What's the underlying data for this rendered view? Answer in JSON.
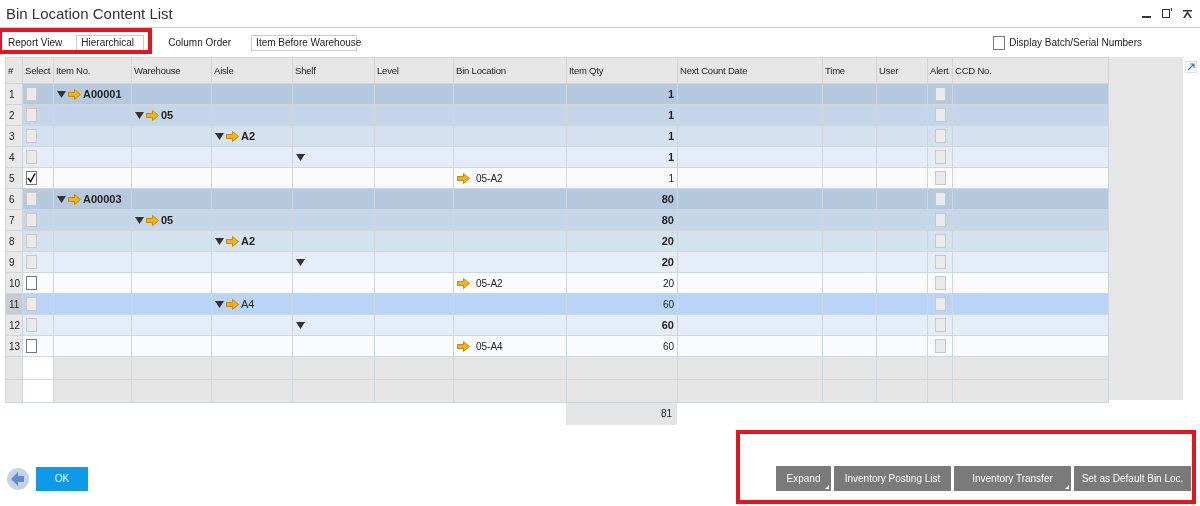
{
  "window": {
    "title": "Bin Location Content List"
  },
  "filters": {
    "highlighted": true,
    "report_view": {
      "label": "Report View",
      "value": "Hierarchical"
    },
    "column_order": {
      "label": "Column Order",
      "value": "Item Before Warehouse"
    },
    "display_batch": {
      "label": "Display Batch/Serial Numbers",
      "checked": false
    }
  },
  "table": {
    "columns": [
      "#",
      "Select",
      "Item No.",
      "Warehouse",
      "Aisle",
      "Shelf",
      "Level",
      "Bin Location",
      "Item Qty",
      "Next Count Date",
      "Time",
      "User",
      "Alert",
      "CCD No."
    ],
    "rows": [
      {
        "num": "1",
        "selected": false,
        "checked": false,
        "alert": false,
        "expanded": true,
        "label": "A00001",
        "qty": "1",
        "children": [
          {
            "num": "2",
            "selected": false,
            "checked": false,
            "alert": false,
            "expanded": true,
            "label": "05",
            "qty": "1",
            "children": [
              {
                "num": "3",
                "selected": false,
                "checked": false,
                "alert": false,
                "expanded": true,
                "label": "A2",
                "qty": "1",
                "children": [
                  {
                    "num": "4",
                    "selected": false,
                    "checked": false,
                    "alert": false,
                    "expanded": true,
                    "qty": "1",
                    "children": [
                      {
                        "num": "5",
                        "selected": false,
                        "checked": true,
                        "alert": false,
                        "label": "05-A2",
                        "qty": "1"
                      }
                    ]
                  }
                ]
              }
            ]
          }
        ]
      },
      {
        "num": "6",
        "selected": false,
        "checked": false,
        "alert": false,
        "expanded": true,
        "label": "A00003",
        "qty": "80",
        "children": [
          {
            "num": "7",
            "selected": false,
            "checked": false,
            "alert": false,
            "expanded": true,
            "label": "05",
            "qty": "80",
            "children": [
              {
                "num": "8",
                "selected": false,
                "checked": false,
                "alert": false,
                "expanded": true,
                "label": "A2",
                "qty": "20",
                "children": [
                  {
                    "num": "9",
                    "selected": false,
                    "checked": false,
                    "alert": false,
                    "expanded": true,
                    "qty": "20",
                    "children": [
                      {
                        "num": "10",
                        "selected": false,
                        "checked": false,
                        "alert": false,
                        "label": "05-A2",
                        "qty": "20"
                      }
                    ]
                  }
                ]
              },
              {
                "num": "11",
                "selected": true,
                "checked": false,
                "alert": false,
                "expanded": true,
                "label": "A4",
                "qty": "60",
                "children": [
                  {
                    "num": "12",
                    "selected": false,
                    "checked": false,
                    "alert": false,
                    "expanded": true,
                    "qty": "60",
                    "children": [
                      {
                        "num": "13",
                        "selected": false,
                        "checked": false,
                        "alert": false,
                        "label": "05-A4",
                        "qty": "60"
                      }
                    ]
                  }
                ]
              }
            ]
          }
        ]
      }
    ],
    "total_qty": "81"
  },
  "ok_button": "OK",
  "actions": {
    "highlighted": true,
    "buttons": [
      {
        "label": "Expand",
        "menu": true
      },
      {
        "label": "Inventory Posting List",
        "menu": false
      },
      {
        "label": "Inventory Transfer",
        "menu": true
      },
      {
        "label": "Set as Default Bin Loc.",
        "menu": false
      }
    ]
  }
}
